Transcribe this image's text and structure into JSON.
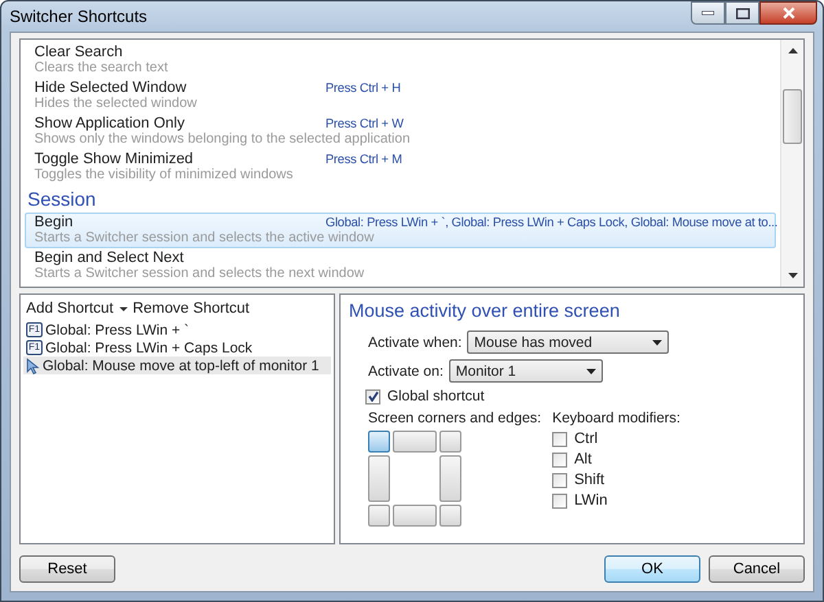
{
  "window": {
    "title": "Switcher Shortcuts"
  },
  "commands": [
    {
      "kind": "command",
      "name": "Clear Search",
      "description": "Clears the search text",
      "selected": false
    },
    {
      "kind": "command",
      "name": "Hide Selected Window",
      "description": "Hides the selected window",
      "shortcut": "Press Ctrl + H",
      "selected": false
    },
    {
      "kind": "command",
      "name": "Show Application Only",
      "description": "Shows only the windows belonging to the selected application",
      "shortcut": "Press Ctrl + W",
      "selected": false
    },
    {
      "kind": "command",
      "name": "Toggle Show Minimized",
      "description": "Toggles the visibility of minimized windows",
      "shortcut": "Press Ctrl + M",
      "selected": false
    },
    {
      "kind": "section",
      "name": "Session"
    },
    {
      "kind": "command",
      "name": "Begin",
      "description": "Starts a Switcher session and selects the active window",
      "shortcut": "Global: Press LWin + `, Global: Press LWin + Caps Lock, Global: Mouse move at to...",
      "selected": true
    },
    {
      "kind": "command",
      "name": "Begin and Select Next",
      "description": "Starts a Switcher session and selects the next window",
      "selected": false
    }
  ],
  "shortcut_editor": {
    "add": "Add Shortcut",
    "remove": "Remove Shortcut",
    "shortcuts": [
      {
        "kind": "keyboard",
        "key": "F1",
        "label": "Global: Press LWin + `",
        "selected": false
      },
      {
        "kind": "keyboard",
        "key": "F1",
        "label": "Global: Press LWin + Caps Lock",
        "selected": false
      },
      {
        "kind": "mouse",
        "label": "Global: Mouse move at top-left of monitor 1",
        "selected": true
      }
    ]
  },
  "details": {
    "title": "Mouse activity over entire screen",
    "activate_when": {
      "label": "Activate when:",
      "value": "Mouse has moved"
    },
    "activate_on": {
      "label": "Activate on:",
      "value": "Monitor 1"
    },
    "global_shortcut": {
      "label": "Global shortcut",
      "checked": true
    },
    "corners_label": "Screen corners and edges:",
    "corners": [
      {
        "selected": true
      },
      {
        "selected": false
      },
      {
        "selected": false
      },
      {
        "selected": false
      },
      {
        "selected": false
      },
      {
        "selected": false
      },
      {
        "selected": false
      },
      {
        "selected": false
      }
    ],
    "modifiers_label": "Keyboard modifiers:",
    "modifiers": [
      {
        "label": "Ctrl",
        "checked": false
      },
      {
        "label": "Alt",
        "checked": false
      },
      {
        "label": "Shift",
        "checked": false
      },
      {
        "label": "LWin",
        "checked": false
      }
    ]
  },
  "buttons": [
    {
      "label": "Reset",
      "kind": "normal"
    },
    {
      "label": "OK",
      "kind": "default"
    },
    {
      "label": "Cancel",
      "kind": "normal"
    }
  ]
}
